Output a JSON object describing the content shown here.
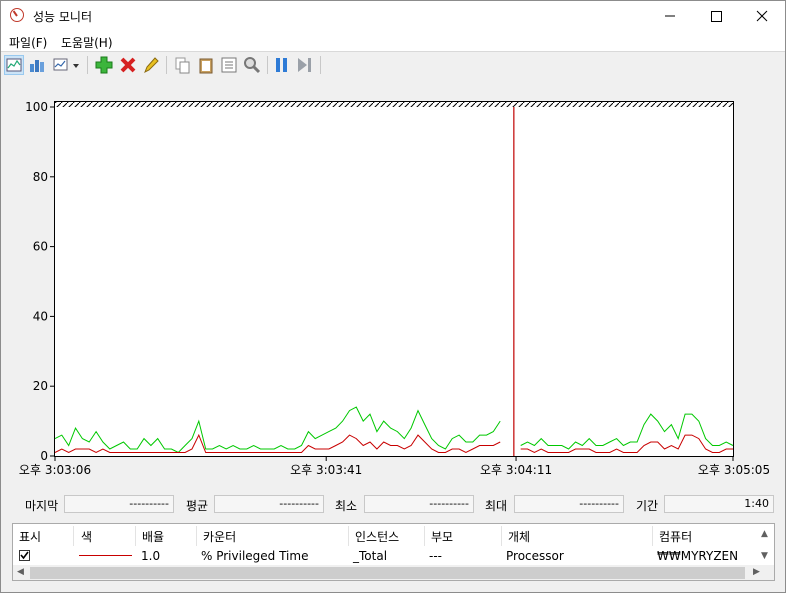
{
  "window": {
    "title": "성능 모니터"
  },
  "menu": {
    "items": [
      "파일(F)",
      "도움말(H)"
    ]
  },
  "toolbar": {
    "buttons": [
      {
        "name": "view-graph-icon"
      },
      {
        "name": "view-histogram-icon"
      },
      {
        "name": "change-graph-type-icon"
      },
      {
        "name": "add-counter-icon"
      },
      {
        "name": "delete-counter-icon"
      },
      {
        "name": "highlight-icon"
      },
      {
        "name": "copy-properties-icon"
      },
      {
        "name": "paste-counter-list-icon"
      },
      {
        "name": "properties-icon"
      },
      {
        "name": "zoom-icon"
      },
      {
        "name": "freeze-display-icon"
      },
      {
        "name": "update-data-icon"
      }
    ]
  },
  "graph": {
    "yticks": [
      "0",
      "20",
      "40",
      "60",
      "80",
      "100"
    ],
    "xticks": [
      "오후 3:03:06",
      "오후 3:03:41",
      "오후 3:04:11",
      "오후 3:05:05"
    ]
  },
  "stats": {
    "last_label": "마지막",
    "last_value": "----------",
    "avg_label": "평균",
    "avg_value": "----------",
    "min_label": "최소",
    "min_value": "----------",
    "max_label": "최대",
    "max_value": "----------",
    "duration_label": "기간",
    "duration_value": "1:40"
  },
  "table": {
    "headers": {
      "show": "표시",
      "color": "색",
      "scale": "배율",
      "counter": "카운터",
      "instance": "인스턴스",
      "parent": "부모",
      "object": "개체",
      "computer": "컴퓨터"
    },
    "row": {
      "scale": "1.0",
      "counter": "% Privileged Time",
      "instance": "_Total",
      "parent": "---",
      "object": "Processor",
      "computer": "₩₩MYRYZEN"
    }
  },
  "chart_data": {
    "type": "line",
    "ylim": [
      0,
      100
    ],
    "samples": 100,
    "time_bar_index": 66,
    "series": [
      {
        "color": "#00c800",
        "values": [
          5,
          6,
          3,
          8,
          5,
          4,
          7,
          4,
          2,
          3,
          4,
          2,
          2,
          5,
          3,
          5,
          2,
          2,
          1,
          3,
          5,
          10,
          2,
          2,
          3,
          2,
          3,
          2,
          2,
          3,
          2,
          2,
          2,
          3,
          2,
          2,
          3,
          7,
          5,
          6,
          7,
          8,
          10,
          13,
          14,
          10,
          12,
          7,
          10,
          8,
          7,
          5,
          8,
          13,
          9,
          5,
          3,
          2,
          5,
          6,
          4,
          4,
          6,
          6,
          7,
          10,
          3,
          2,
          3,
          4,
          3,
          5,
          3,
          3,
          3,
          2,
          4,
          3,
          5,
          3,
          3,
          4,
          5,
          3,
          4,
          4,
          9,
          12,
          10,
          7,
          9,
          5,
          12,
          12,
          10,
          5,
          3,
          3,
          4,
          3
        ]
      },
      {
        "color": "#c80000",
        "values": [
          1,
          2,
          1,
          2,
          2,
          2,
          1,
          2,
          1,
          1,
          1,
          1,
          1,
          1,
          1,
          1,
          1,
          1,
          1,
          1,
          2,
          6,
          1,
          1,
          1,
          1,
          1,
          1,
          1,
          1,
          1,
          1,
          1,
          1,
          1,
          1,
          1,
          3,
          2,
          2,
          2,
          3,
          4,
          6,
          5,
          3,
          4,
          2,
          4,
          3,
          3,
          2,
          3,
          6,
          4,
          2,
          1,
          1,
          2,
          2,
          1,
          2,
          3,
          3,
          3,
          4,
          1,
          1,
          2,
          2,
          1,
          2,
          1,
          1,
          1,
          1,
          2,
          2,
          2,
          1,
          1,
          1,
          2,
          1,
          1,
          1,
          3,
          4,
          4,
          2,
          3,
          2,
          6,
          6,
          5,
          2,
          1,
          1,
          2,
          2
        ]
      }
    ]
  }
}
